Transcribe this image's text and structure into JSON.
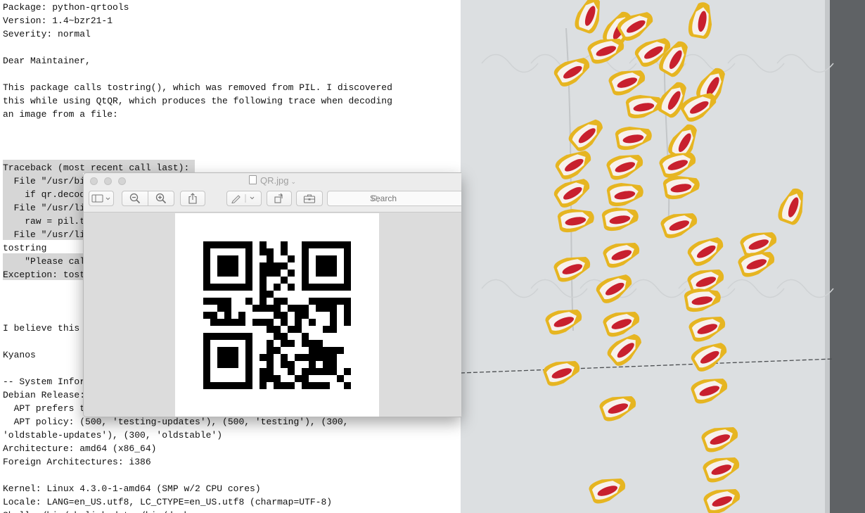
{
  "email": {
    "lines": [
      "Package: python-qrtools",
      "Version: 1.4~bzr21-1",
      "Severity: normal",
      "",
      "Dear Maintainer,",
      "",
      "This package calls tostring(), which was removed from PIL. I discovered",
      "this while using QtQR, which produces the following trace when decoding",
      "an image from a file:",
      "",
      "",
      "",
      "Traceback (most recent call last):",
      "  File \"/usr/bi",
      "    if qr.decod",
      "  File \"/usr/li",
      "    raw = pil.t",
      "  File \"/usr/li",
      "tostring",
      "    \"Please cal",
      "Exception: tost",
      "",
      "",
      "",
      "I believe this",
      "",
      "Kyanos",
      "",
      "-- System Infor",
      "Debian Release:",
      "  APT prefers t",
      "  APT policy: (500, 'testing-updates'), (500, 'testing'), (300,",
      "'oldstable-updates'), (300, 'oldstable')",
      "Architecture: amd64 (x86_64)",
      "Foreign Architectures: i386",
      "",
      "Kernel: Linux 4.3.0-1-amd64 (SMP w/2 CPU cores)",
      "Locale: LANG=en_US.utf8, LC_CTYPE=en_US.utf8 (charmap=UTF-8)",
      "Shell: /bin/sh linked to /bin/dash"
    ]
  },
  "preview": {
    "title": "QR.jpg",
    "title_chevron": "⌄",
    "search_placeholder": "Search",
    "toolbar": [
      {
        "icon": "sidebar-icon"
      },
      {
        "icon": "zoom-out-icon"
      },
      {
        "icon": "zoom-in-icon"
      },
      {
        "icon": "share-icon"
      },
      {
        "icon": "markup-icon"
      },
      {
        "icon": "rotate-icon"
      },
      {
        "icon": "toolbox-icon"
      }
    ]
  },
  "qr_code": {
    "modules": 21,
    "rows": [
      "111111101001001111111",
      "100000101101001000001",
      "101110100100101011101",
      "101110101111001011101",
      "101110101110101011101",
      "100000101001001000001",
      "111111101010101111111",
      "000000001100000000000",
      "111100101011000111111",
      "001100011110111011101",
      "110101000011011000101",
      "011111011101010100101",
      "000000000110110001100",
      "111111100011001000000",
      "100000100101101110000",
      "101110100110000111110",
      "101110101101011111100",
      "101110100101100101100",
      "100000101100101111101",
      "100000101110011000010",
      "111111101011101111001"
    ]
  },
  "colors": {
    "selection": "#d6d6d6",
    "paper_towel": "#dcdfe1",
    "kernel_tip": "#c8202e",
    "kernel_body": "#e6b521"
  }
}
